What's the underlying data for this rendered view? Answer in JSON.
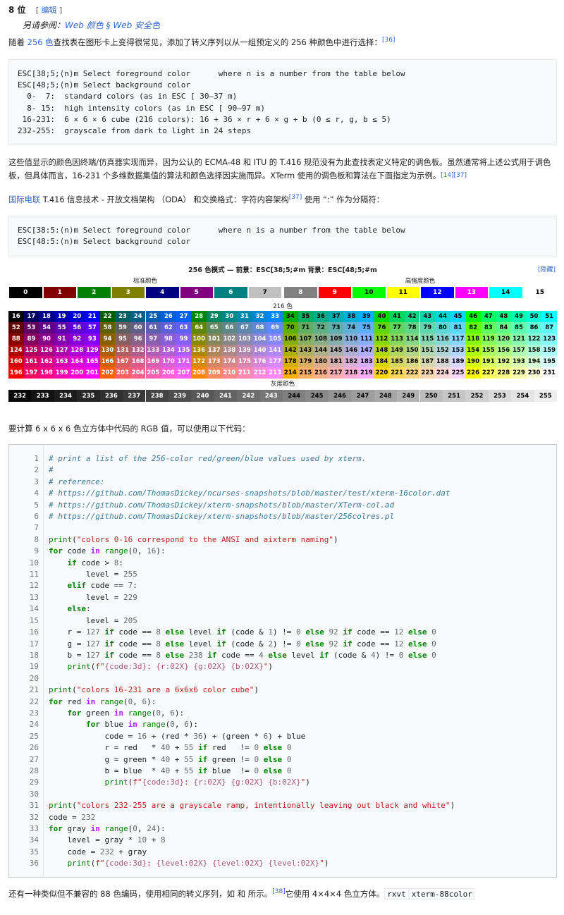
{
  "heading": {
    "title": "8 位",
    "edit_open": "[",
    "edit_label": "编辑",
    "edit_close": "]"
  },
  "hatnote": {
    "prefix": "另请参阅：",
    "link1": "Web 颜色",
    "sep": " § ",
    "link2": "Web 安全色"
  },
  "p1": {
    "before": "随着 ",
    "link": "256 色",
    "after": "查找表在图形卡上变得很常见，添加了转义序列以从一组预定义的 256 种颜色中进行选择：",
    "ref": "[36]"
  },
  "code1": "ESC[38;5;⟨n⟩m Select foreground color      where n is a number from the table below\nESC[48;5;⟨n⟩m Select background color\n  0-  7:  standard colors (as in ESC [ 30–37 m)\n  8- 15:  high intensity colors (as in ESC [ 90–97 m)\n 16-231:  6 × 6 × 6 cube (216 colors): 16 + 36 × r + 6 × g + b (0 ≤ r, g, b ≤ 5)\n232-255:  grayscale from dark to light in 24 steps",
  "p2": {
    "text1": "这些值显示的颜色因终端/仿真器实现而异，因为公认的 ECMA-48 和 ITU 的 T.416 规范没有为此查找表定义特定的调色板。虽然通常将上述公式用于调色板，但具体而言，16-231 个多维数据集值的算法和颜色选择因实施而异。XTerm 使用的调色板和算法在下面指定为示例。",
    "ref": "[14][37]"
  },
  "p3": {
    "link": "国际电联",
    "text": " T.416 信息技术 - 开放文档架构 （ODA） 和交换格式：字符内容架构",
    "ref": "[37]",
    "after": " 使用 “:” 作为分隔符："
  },
  "code2": "ESC[38:5:⟨n⟩m Select foreground color      where n is a number from the table below\nESC[48:5:⟨n⟩m Select background color",
  "table": {
    "title": "256 色模式 — 前景：ESC[38;5;#m 背景：ESC[48;5;#m",
    "hide": "[隐藏]",
    "standard_label": "标准颜色",
    "high_label": "高强度颜色",
    "cube_label": "216 色",
    "gray_label": "灰度颜色",
    "standard_colors": [
      "#000000",
      "#800000",
      "#008000",
      "#808000",
      "#000080",
      "#800080",
      "#008080",
      "#c0c0c0"
    ],
    "high_colors": [
      "#808080",
      "#ff0000",
      "#00ff00",
      "#ffff00",
      "#0000ff",
      "#ff00ff",
      "#00ffff",
      "#ffffff"
    ]
  },
  "p4": "要计算 6 x 6 x 6 色立方体中代码的 RGB 值，可以使用以下代码：",
  "p5": {
    "text": "还有一种类似但不兼容的 88 色编码，使用相同的转义序列，如 和 所示。",
    "ref": "[38]",
    "after": "它使用 4×4×4 色立方体。",
    "code1": "rxvt",
    "code2": "xterm-88color"
  }
}
